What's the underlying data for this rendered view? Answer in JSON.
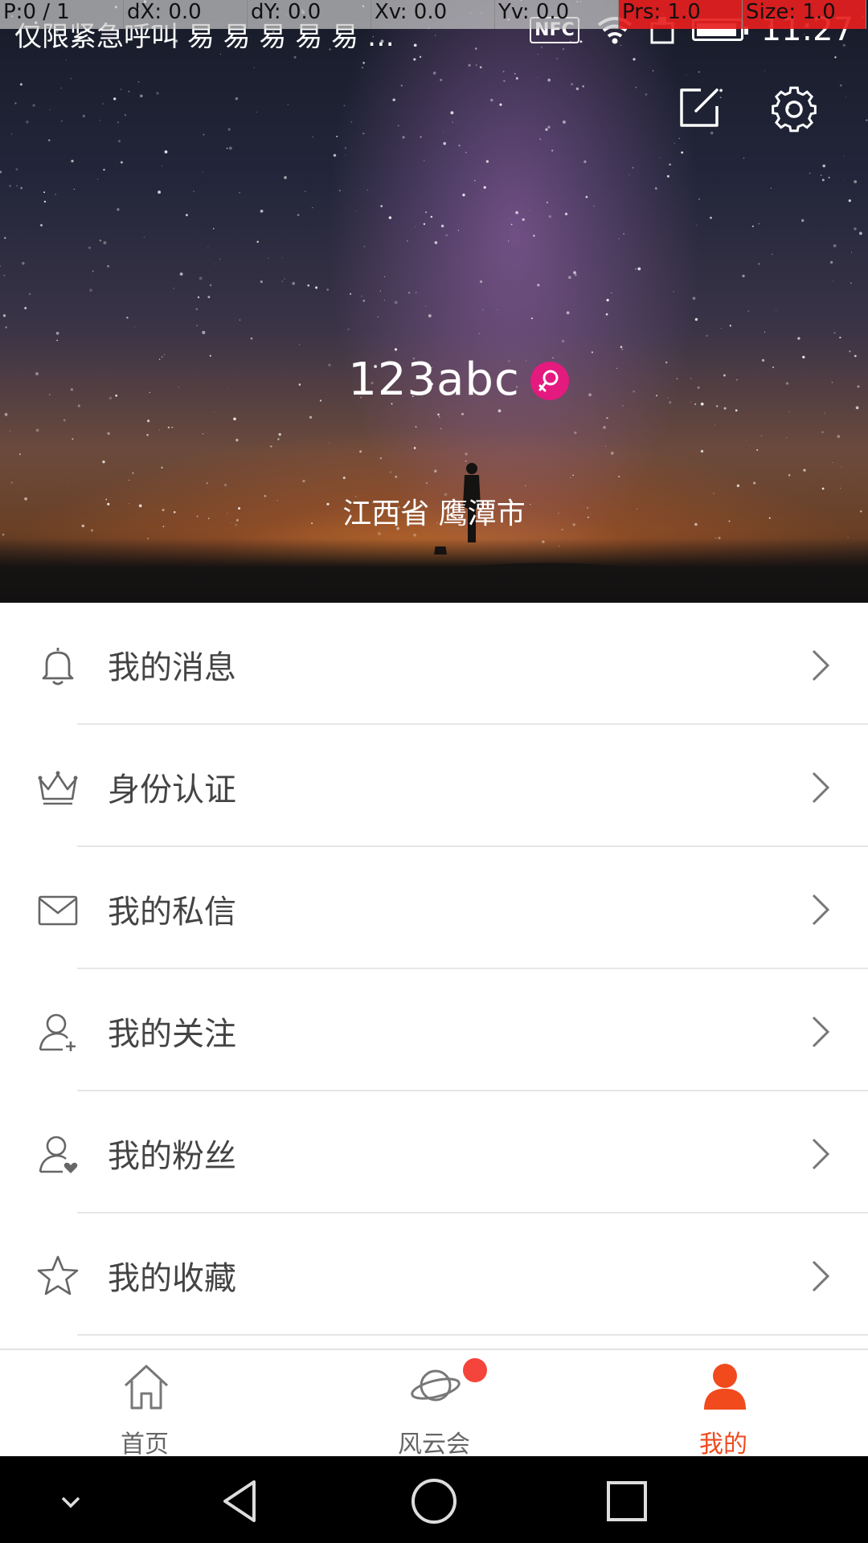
{
  "debug_bar": [
    "P:0 / 1",
    "dX: 0.0",
    "dY: 0.0",
    "Xv: 0.0",
    "Yv: 0.0",
    "Prs: 1.0",
    "Size: 1.0"
  ],
  "status_bar": {
    "carrier": "仅限紧急呼叫",
    "notification_icons": "易 易 易 易 易 …",
    "nfc": "NFC",
    "time": "11:27",
    "battery_level": 0.95
  },
  "profile": {
    "username": "123abc",
    "gender_icon": "female-icon",
    "location": "江西省 鹰潭市"
  },
  "header_actions": {
    "edit_icon": "edit-icon",
    "settings_icon": "gear-icon"
  },
  "menu": {
    "items": [
      {
        "label": "我的消息",
        "icon": "bell-icon"
      },
      {
        "label": "身份认证",
        "icon": "crown-icon"
      },
      {
        "label": "我的私信",
        "icon": "mail-icon"
      },
      {
        "label": "我的关注",
        "icon": "user-plus-icon"
      },
      {
        "label": "我的粉丝",
        "icon": "user-heart-icon"
      },
      {
        "label": "我的收藏",
        "icon": "star-icon"
      }
    ]
  },
  "tabbar": {
    "tabs": [
      {
        "label": "首页",
        "icon": "home-icon",
        "active": false
      },
      {
        "label": "风云会",
        "icon": "planet-icon",
        "active": false,
        "badge": true
      },
      {
        "label": "我的",
        "icon": "person-icon",
        "active": true
      }
    ]
  },
  "colors": {
    "accent": "#f04a1d",
    "badge": "#f5443b",
    "gender_badge": "#e41a7f",
    "menu_text": "#444444"
  }
}
